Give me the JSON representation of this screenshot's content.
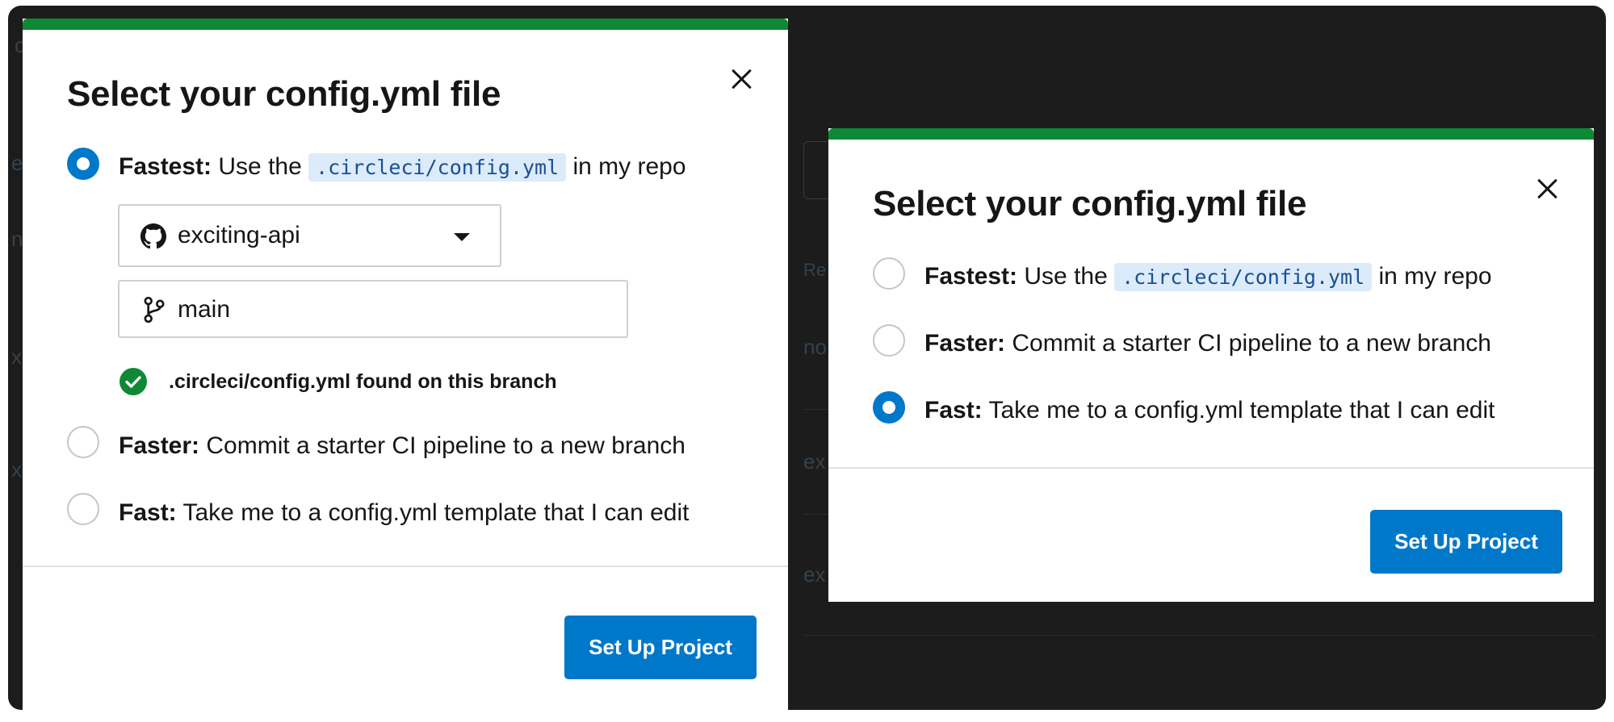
{
  "background": {
    "fragments": [
      "c",
      "e",
      "no",
      "x",
      "x",
      "Re",
      "no",
      "ex",
      "ex"
    ]
  },
  "modal_a": {
    "title": "Select your config.yml file",
    "options": [
      {
        "strong": "Fastest:",
        "pre": "Use the",
        "code": ".circleci/config.yml",
        "post": "in my repo",
        "checked": true
      },
      {
        "strong": "Faster:",
        "text": "Commit a starter CI pipeline to a new branch",
        "checked": false
      },
      {
        "strong": "Fast:",
        "text": "Take me to a config.yml template that I can edit",
        "checked": false
      }
    ],
    "repo_select": {
      "value": "exciting-api",
      "icon": "github-icon"
    },
    "branch_select": {
      "value": "main",
      "icon": "git-branch-icon"
    },
    "status": ".circleci/config.yml found on this branch",
    "button": "Set Up Project"
  },
  "modal_b": {
    "title": "Select your config.yml file",
    "options": [
      {
        "strong": "Fastest:",
        "pre": "Use the",
        "code": ".circleci/config.yml",
        "post": "in my repo",
        "checked": false
      },
      {
        "strong": "Faster:",
        "text": "Commit a starter CI pipeline to a new branch",
        "checked": false
      },
      {
        "strong": "Fast:",
        "text": "Take me to a config.yml template that I can edit",
        "checked": true
      }
    ],
    "button": "Set Up Project"
  },
  "colors": {
    "accent": "#0078ca",
    "header_bar": "#0d8935",
    "success": "#0d8935",
    "backdrop": "#1c1c1c"
  }
}
